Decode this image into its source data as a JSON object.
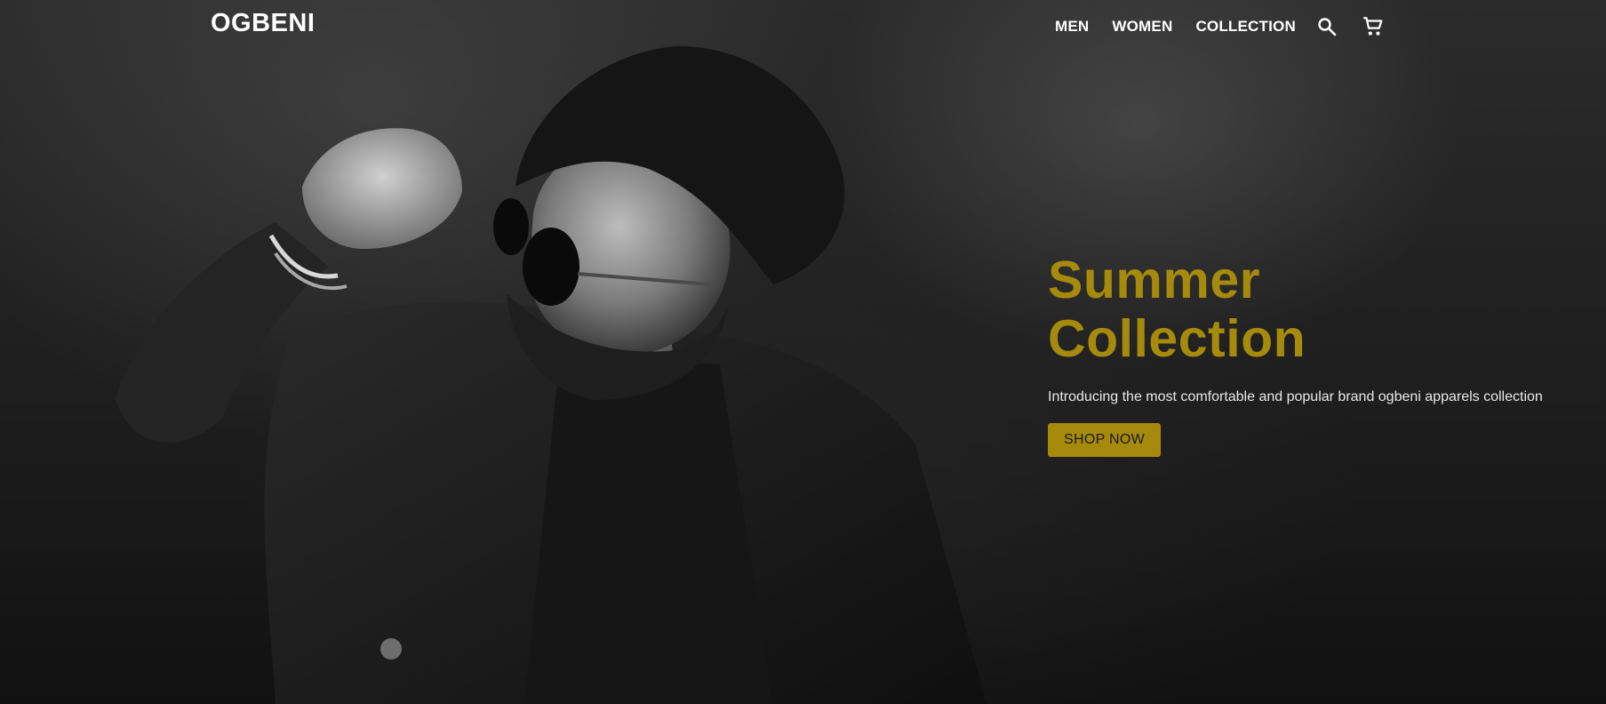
{
  "brand": {
    "name": "OGBENI"
  },
  "nav": {
    "links": [
      "MEN",
      "WOMEN",
      "COLLECTION"
    ],
    "icons": [
      "search-icon",
      "cart-icon"
    ]
  },
  "hero": {
    "title_line1": "Summer",
    "title_line2": "Collection",
    "subtitle": "Introducing the most comfortable and popular brand ogbeni apparels collection",
    "cta_label": "SHOP NOW",
    "accent_color": "#a68a0c",
    "image_description": "black-and-white photo of man in sunglasses and dark jacket"
  }
}
